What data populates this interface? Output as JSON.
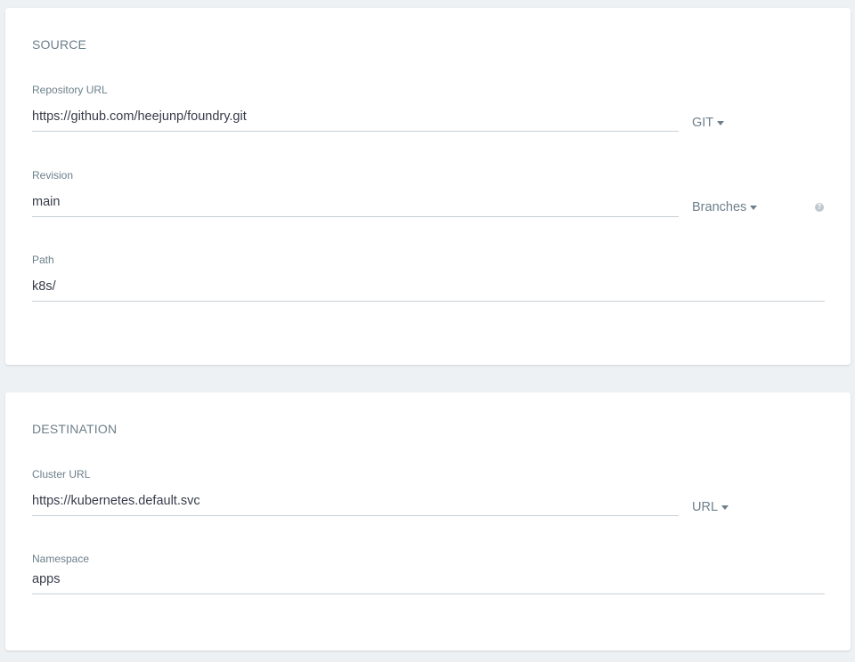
{
  "source": {
    "title": "SOURCE",
    "repo": {
      "label": "Repository URL",
      "value": "https://github.com/heejunp/foundry.git",
      "type_label": "GIT"
    },
    "revision": {
      "label": "Revision",
      "value": "main",
      "type_label": "Branches",
      "help_icon": "?"
    },
    "path": {
      "label": "Path",
      "value": "k8s/"
    }
  },
  "destination": {
    "title": "DESTINATION",
    "cluster": {
      "label": "Cluster URL",
      "value": "https://kubernetes.default.svc",
      "type_label": "URL"
    },
    "namespace": {
      "label": "Namespace",
      "value": "apps"
    }
  },
  "colors": {
    "background": "#eef1f4",
    "card": "#ffffff",
    "label": "#6d7f8b",
    "text": "#363c4a",
    "underline": "#c8d0d6"
  }
}
